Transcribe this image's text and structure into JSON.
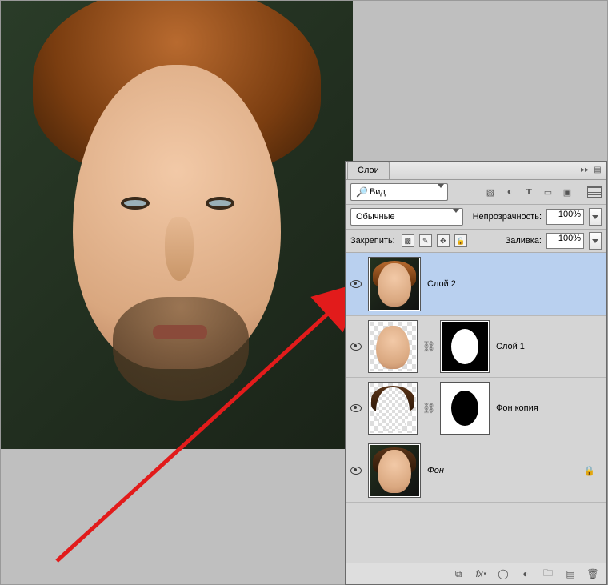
{
  "panel": {
    "tab_label": "Слои",
    "search_label": "Вид",
    "blend_mode": "Обычные",
    "opacity_label": "Непрозрачность:",
    "opacity_value": "100%",
    "lock_label": "Закрепить:",
    "fill_label": "Заливка:",
    "fill_value": "100%"
  },
  "layers": [
    {
      "name": "Слой 2",
      "selected": true,
      "masked": false,
      "locked": false,
      "bg_italic": false
    },
    {
      "name": "Слой 1",
      "selected": false,
      "masked": true,
      "mask": "white_on_black",
      "bg_italic": false
    },
    {
      "name": "Фон копия",
      "selected": false,
      "masked": true,
      "mask": "black_on_white",
      "bg_italic": false
    },
    {
      "name": "Фон",
      "selected": false,
      "masked": false,
      "locked": true,
      "bg_italic": true
    }
  ]
}
